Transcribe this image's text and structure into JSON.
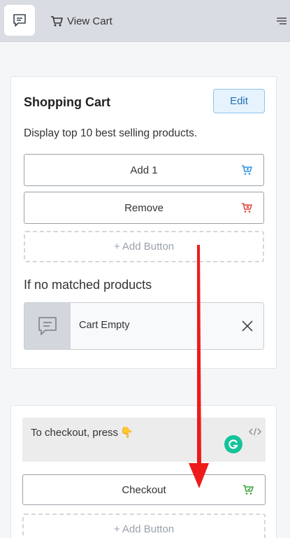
{
  "header": {
    "title": "View Cart",
    "icons": {
      "left": "chat-bubble-icon",
      "title": "cart-icon",
      "menu": "menu-lines-icon"
    }
  },
  "card": {
    "title": "Shopping Cart",
    "edit_label": "Edit",
    "description": "Display top 10 best selling products.",
    "buttons": [
      {
        "label": "Add 1",
        "icon": "cart-add-icon",
        "color": "#2d8fe0"
      },
      {
        "label": "Remove",
        "icon": "cart-remove-icon",
        "color": "#e0403a"
      }
    ],
    "add_button_label": "+ Add Button",
    "no_match_heading": "If no matched products",
    "empty_block": {
      "label": "Cart Empty",
      "icon": "chat-bubble-icon"
    }
  },
  "card2": {
    "text": "To checkout, press",
    "emoji": "👇",
    "button": {
      "label": "Checkout",
      "icon": "cart-checkout-icon",
      "color": "#3aa33a"
    },
    "add_button_label": "+ Add Button"
  },
  "colors": {
    "header_bg": "#d9dde3",
    "edit_bg": "#e6f3fd",
    "edit_border": "#8fc3ec",
    "arrow": "#ee1b1b",
    "grammarly": "#15c39a"
  }
}
